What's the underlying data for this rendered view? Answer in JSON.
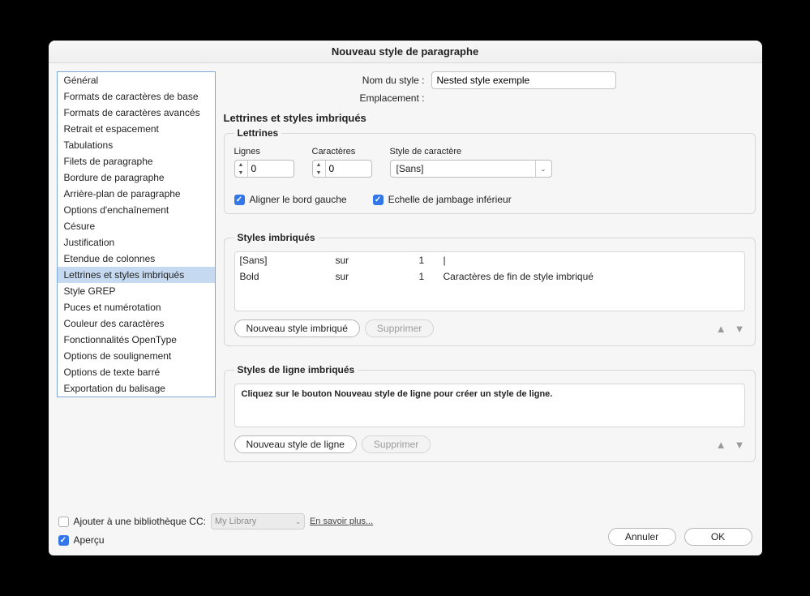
{
  "dialog": {
    "title": "Nouveau style de paragraphe",
    "style_name_label": "Nom du style :",
    "style_name_value": "Nested style exemple",
    "location_label": "Emplacement :",
    "section_title": "Lettrines et styles imbriqués"
  },
  "sidebar": {
    "items": [
      "Général",
      "Formats de caractères de base",
      "Formats de caractères avancés",
      "Retrait et espacement",
      "Tabulations",
      "Filets de paragraphe",
      "Bordure de paragraphe",
      "Arrière-plan de paragraphe",
      "Options d'enchaînement",
      "Césure",
      "Justification",
      "Etendue de colonnes",
      "Lettrines et styles imbriqués",
      "Style GREP",
      "Puces et numérotation",
      "Couleur des caractères",
      "Fonctionnalités OpenType",
      "Options de soulignement",
      "Options de texte barré",
      "Exportation du balisage"
    ],
    "selected_index": 12
  },
  "dropcaps": {
    "legend": "Lettrines",
    "lines_label": "Lignes",
    "lines_value": "0",
    "chars_label": "Caractères",
    "chars_value": "0",
    "char_style_label": "Style de caractère",
    "char_style_value": "[Sans]",
    "align_left_label": "Aligner le bord gauche",
    "descender_label": "Echelle de jambage inférieur"
  },
  "nested": {
    "legend": "Styles imbriqués",
    "rows": [
      {
        "style": "[Sans]",
        "sur": "sur",
        "count": "1",
        "end": "|"
      },
      {
        "style": "Bold",
        "sur": "sur",
        "count": "1",
        "end": "Caractères de fin de style imbriqué"
      }
    ],
    "new_btn": "Nouveau style imbriqué",
    "delete_btn": "Supprimer"
  },
  "line_styles": {
    "legend": "Styles de ligne imbriqués",
    "placeholder": "Cliquez sur le bouton Nouveau style de ligne pour créer un style de ligne.",
    "new_btn": "Nouveau style de ligne",
    "delete_btn": "Supprimer"
  },
  "footer": {
    "add_cc_label": "Ajouter à une bibliothèque CC:",
    "lib_value": "My Library",
    "learn_more": "En savoir plus...",
    "preview_label": "Aperçu",
    "cancel": "Annuler",
    "ok": "OK"
  }
}
